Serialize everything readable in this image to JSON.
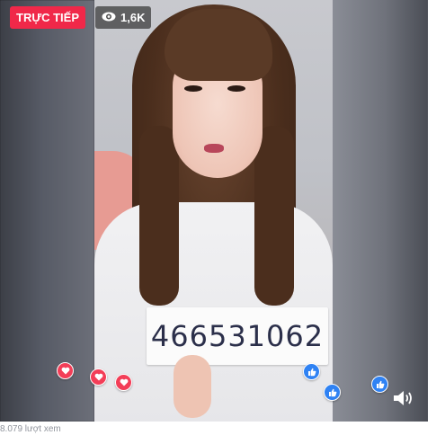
{
  "live_badge": {
    "label": "TRỰC TIẾP",
    "color": "#f02849"
  },
  "viewers": {
    "icon": "eye-icon",
    "count": "1,6K"
  },
  "sign": {
    "text": "466531062"
  },
  "reactions": [
    {
      "type": "love",
      "icon": "heart-icon"
    },
    {
      "type": "love",
      "icon": "heart-icon"
    },
    {
      "type": "love",
      "icon": "heart-icon"
    },
    {
      "type": "like",
      "icon": "thumbs-up-icon"
    },
    {
      "type": "like",
      "icon": "thumbs-up-icon"
    },
    {
      "type": "like",
      "icon": "thumbs-up-icon"
    }
  ],
  "volume": {
    "icon": "speaker-volume-icon"
  },
  "caption": {
    "text": "8.079 lượt xem"
  },
  "colors": {
    "like": "#2f82f3",
    "love": "#f33e58"
  }
}
